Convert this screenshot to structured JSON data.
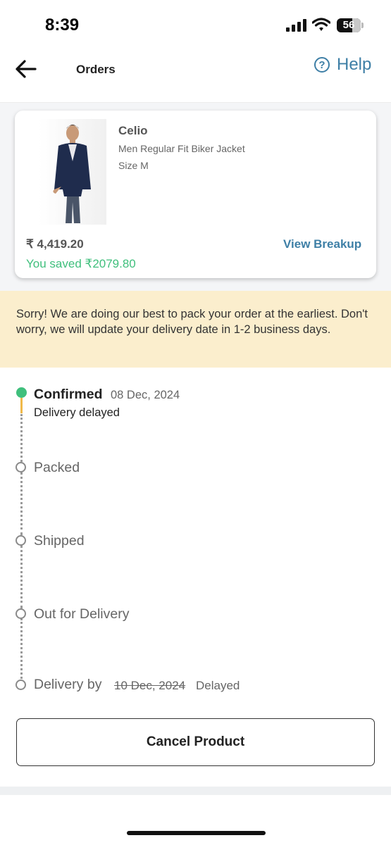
{
  "status_bar": {
    "time": "8:39",
    "battery": "56"
  },
  "header": {
    "title": "Orders",
    "help_label": "Help",
    "help_icon_glyph": "?"
  },
  "product": {
    "brand": "Celio",
    "name": "Men Regular Fit Biker Jacket",
    "size": "Size M",
    "price": "₹ 4,419.20",
    "saved": "You saved ₹2079.80",
    "view_breakup": "View Breakup"
  },
  "notice": {
    "text": "Sorry! We are doing our best to pack your order at the earliest. Don't worry, we will update your delivery date in 1-2 business days."
  },
  "timeline": {
    "confirmed": {
      "label": "Confirmed",
      "date": "08 Dec, 2024",
      "sub": "Delivery delayed"
    },
    "packed": "Packed",
    "shipped": "Shipped",
    "out_for_delivery": "Out for Delivery",
    "delivery": {
      "label": "Delivery by",
      "date": "10 Dec, 2024",
      "status": "Delayed"
    }
  },
  "actions": {
    "cancel_label": "Cancel Product"
  },
  "colors": {
    "accent": "#3e7fa6",
    "success": "#3fbf7c",
    "notice_bg": "#fbeecd",
    "delay": "#f0b94a"
  }
}
